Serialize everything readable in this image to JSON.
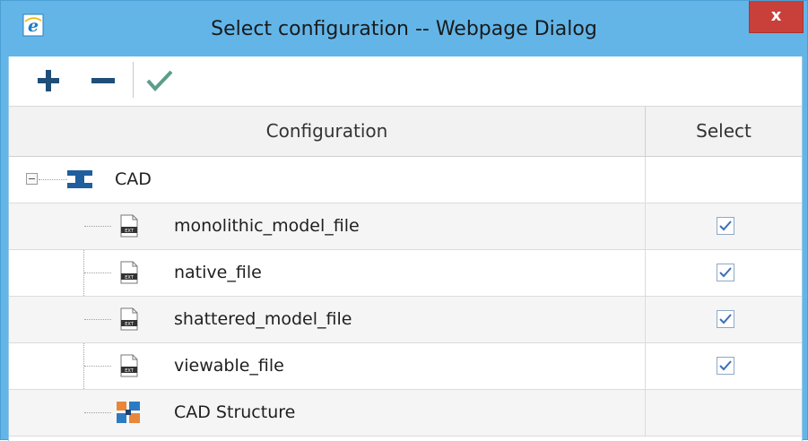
{
  "window": {
    "title": "Select configuration -- Webpage Dialog",
    "close_label": "x",
    "app_icon": "internet-explorer-icon"
  },
  "toolbar": {
    "buttons": [
      {
        "name": "add",
        "icon": "plus-icon",
        "color": "#1f4e79"
      },
      {
        "name": "remove",
        "icon": "minus-icon",
        "color": "#1f4e79"
      },
      {
        "name": "ok",
        "icon": "check-icon",
        "color": "#5b9e8a"
      }
    ]
  },
  "grid": {
    "columns": [
      "Configuration",
      "Select"
    ],
    "root": {
      "label": "CAD",
      "icon": "cad-assembly-icon",
      "expanded": true
    },
    "rows": [
      {
        "label": "monolithic_model_file",
        "icon": "ext-file-icon",
        "selected": true
      },
      {
        "label": "native_file",
        "icon": "ext-file-icon",
        "selected": true
      },
      {
        "label": "shattered_model_file",
        "icon": "ext-file-icon",
        "selected": true
      },
      {
        "label": "viewable_file",
        "icon": "ext-file-icon",
        "selected": true
      },
      {
        "label": "CAD Structure",
        "icon": "cad-structure-icon",
        "selected": false
      }
    ]
  },
  "colors": {
    "titlebar": "#63b5e8",
    "close_button": "#c9403a",
    "check": "#3a6fb5"
  }
}
